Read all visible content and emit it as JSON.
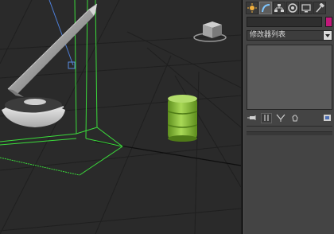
{
  "command_panel": {
    "tabs": [
      {
        "name": "create",
        "icon": "sun-create-icon"
      },
      {
        "name": "modify",
        "icon": "modify-arc-icon"
      },
      {
        "name": "hierarchy",
        "icon": "hierarchy-icon"
      },
      {
        "name": "motion",
        "icon": "motion-icon"
      },
      {
        "name": "display",
        "icon": "display-monitor-icon"
      },
      {
        "name": "utilities",
        "icon": "hammer-icon"
      }
    ],
    "active_tab": "modify",
    "object_name": "",
    "object_color": "#c2187a",
    "modifier_list_label": "修改器列表",
    "stack_tools": [
      "pin-stack-icon",
      "show-end-result-icon",
      "make-unique-icon",
      "remove-modifier-icon",
      "configure-sets-icon"
    ]
  },
  "viewport": {
    "background": "#2a2a2a",
    "grid_color": "#1f1f1f",
    "selection_color": "#3bdc3b",
    "barrel_color": "#8ec63f"
  }
}
